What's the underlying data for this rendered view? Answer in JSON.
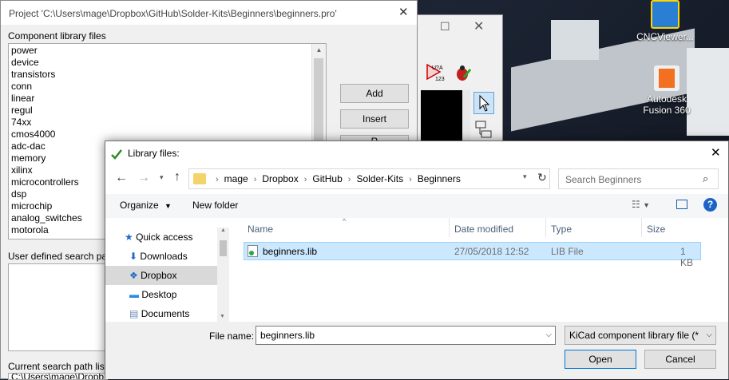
{
  "desktop": {
    "icons": [
      {
        "label": "CNCViewer..."
      },
      {
        "label": "Autodesk Fusion 360"
      }
    ]
  },
  "project_dialog": {
    "title": "Project 'C:\\Users\\mage\\Dropbox\\GitHub\\Solder-Kits\\Beginners\\beginners.pro'",
    "component_label": "Component library files",
    "libraries": [
      "power",
      "device",
      "transistors",
      "conn",
      "linear",
      "regul",
      "74xx",
      "cmos4000",
      "adc-dac",
      "memory",
      "xilinx",
      "microcontrollers",
      "dsp",
      "microchip",
      "analog_switches",
      "motorola"
    ],
    "buttons": {
      "add": "Add",
      "insert": "Insert",
      "remove_partial": "R"
    },
    "user_search_label": "User defined search pat",
    "current_search_label": "Current search path list",
    "current_search_value": "C:\\Users\\mage\\Dropb"
  },
  "back_window": {
    "toolbar_text": "U?A\n123"
  },
  "file_dialog": {
    "title": "Library files:",
    "breadcrumb": [
      "mage",
      "Dropbox",
      "GitHub",
      "Solder-Kits",
      "Beginners"
    ],
    "search_placeholder": "Search Beginners",
    "toolbar": {
      "organize": "Organize",
      "new_folder": "New folder"
    },
    "nav": {
      "quick_access": "Quick access",
      "downloads": "Downloads",
      "dropbox": "Dropbox",
      "desktop": "Desktop",
      "documents": "Documents"
    },
    "columns": {
      "name": "Name",
      "date": "Date modified",
      "type": "Type",
      "size": "Size"
    },
    "files": [
      {
        "name": "beginners.lib",
        "date": "27/05/2018 12:52",
        "type": "LIB File",
        "size": "1 KB"
      }
    ],
    "filename_label": "File name:",
    "filename_value": "beginners.lib",
    "filetype_value": "KiCad component library file (*",
    "open_label": "Open",
    "cancel_label": "Cancel"
  }
}
